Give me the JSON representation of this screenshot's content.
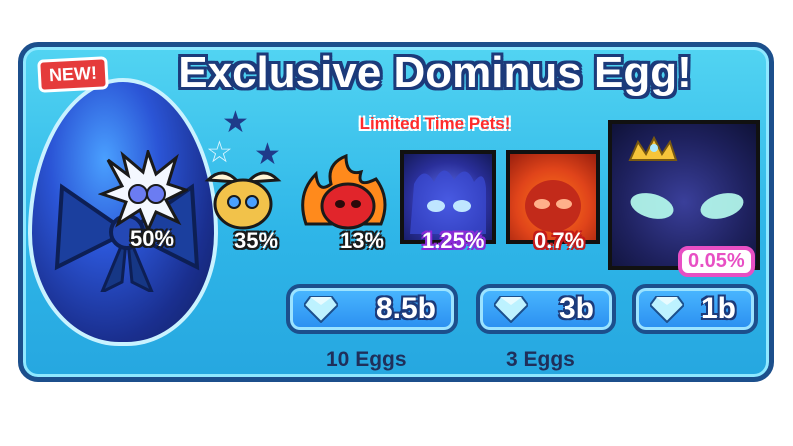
{
  "badge": {
    "label": "NEW!"
  },
  "header": {
    "title": "Exclusive Dominus Egg!",
    "subtitle": "Limited Time Pets!"
  },
  "pets": [
    {
      "chance": "50%",
      "icon": "lightning-pet-icon"
    },
    {
      "chance": "35%",
      "icon": "winged-pet-icon"
    },
    {
      "chance": "13%",
      "icon": "fire-pet-icon"
    },
    {
      "chance": "1.25%",
      "icon": "blue-dominus-icon"
    },
    {
      "chance": "0.7%",
      "icon": "flame-dominus-icon"
    },
    {
      "chance": "0.05%",
      "icon": "crowned-dominus-icon"
    }
  ],
  "purchase": [
    {
      "price": "8.5b",
      "eggs": "10 Eggs"
    },
    {
      "price": "3b",
      "eggs": "3 Eggs"
    },
    {
      "price": "1b",
      "eggs": ""
    }
  ],
  "colors": {
    "panel_border": "#1c4f8c",
    "subtitle": "#ff2b2b",
    "rare_badge": "#e84fc4"
  }
}
